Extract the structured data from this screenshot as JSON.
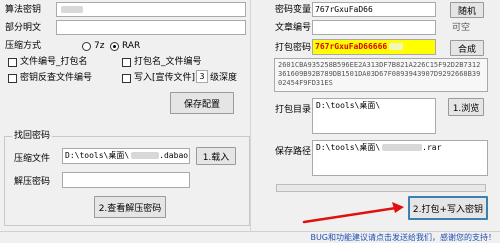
{
  "left": {
    "algorithm_key_label": "算法密钥",
    "algorithm_key_value": "",
    "partial_plain_label": "部分明文",
    "partial_plain_value": "",
    "compress_label": "压缩方式",
    "compress_options": [
      "7z",
      "RAR"
    ],
    "compress_selected": "RAR",
    "check_doc_no_pkg": "文件编号_打包名",
    "check_pkg_doc_no": "打包名_文件编号",
    "check_key_reverse": "密钥反查文件编号",
    "check_write_file": "写入[宣传文件]",
    "depth_value": "3",
    "depth_label": "级深度",
    "save_config": "保存配置",
    "retrieve_group_title": "找回密码",
    "compressed_file_label": "压缩文件",
    "compressed_file_value": "D:\\tools\\桌面\\",
    "compressed_file_tail": ".dabao",
    "load_button": "1.载入",
    "unzip_pw_label": "解压密码",
    "unzip_pw_value": "",
    "view_pw_button": "2.查看解压密码"
  },
  "right": {
    "pw_var_label": "密码变量",
    "pw_var_value": "767rGxuFaD66",
    "random_button": "随机",
    "doc_no_label": "文章编号",
    "doc_no_value": "",
    "nullable": "可空",
    "pack_pw_label": "打包密码",
    "pack_pw_value": "767rGxuFaD66666",
    "combine_button": "合成",
    "hash_text": "2601CBA935258B596EE2A313DF7B821A226C15F92D2B7312361609B92B789DB1501DA03D67F0893943907D9292668B3902454F9FD31ES",
    "pack_dir_label": "打包目录",
    "pack_dir_value": "D:\\tools\\桌面\\",
    "browse_button": "1.浏览",
    "save_path_label": "保存路径",
    "save_path_value": "D:\\tools\\桌面\\",
    "save_path_tail": ".rar",
    "pack_write_button": "2.打包+写入密钥"
  },
  "footer": {
    "text": "BUG和功能建议请点击发送给我们，感谢您的支持！"
  },
  "colors": {
    "highlight_bg": "#ffff00",
    "highlight_fg": "#e00000",
    "arrow": "#e01010",
    "footer_text": "#1f4fb5"
  }
}
